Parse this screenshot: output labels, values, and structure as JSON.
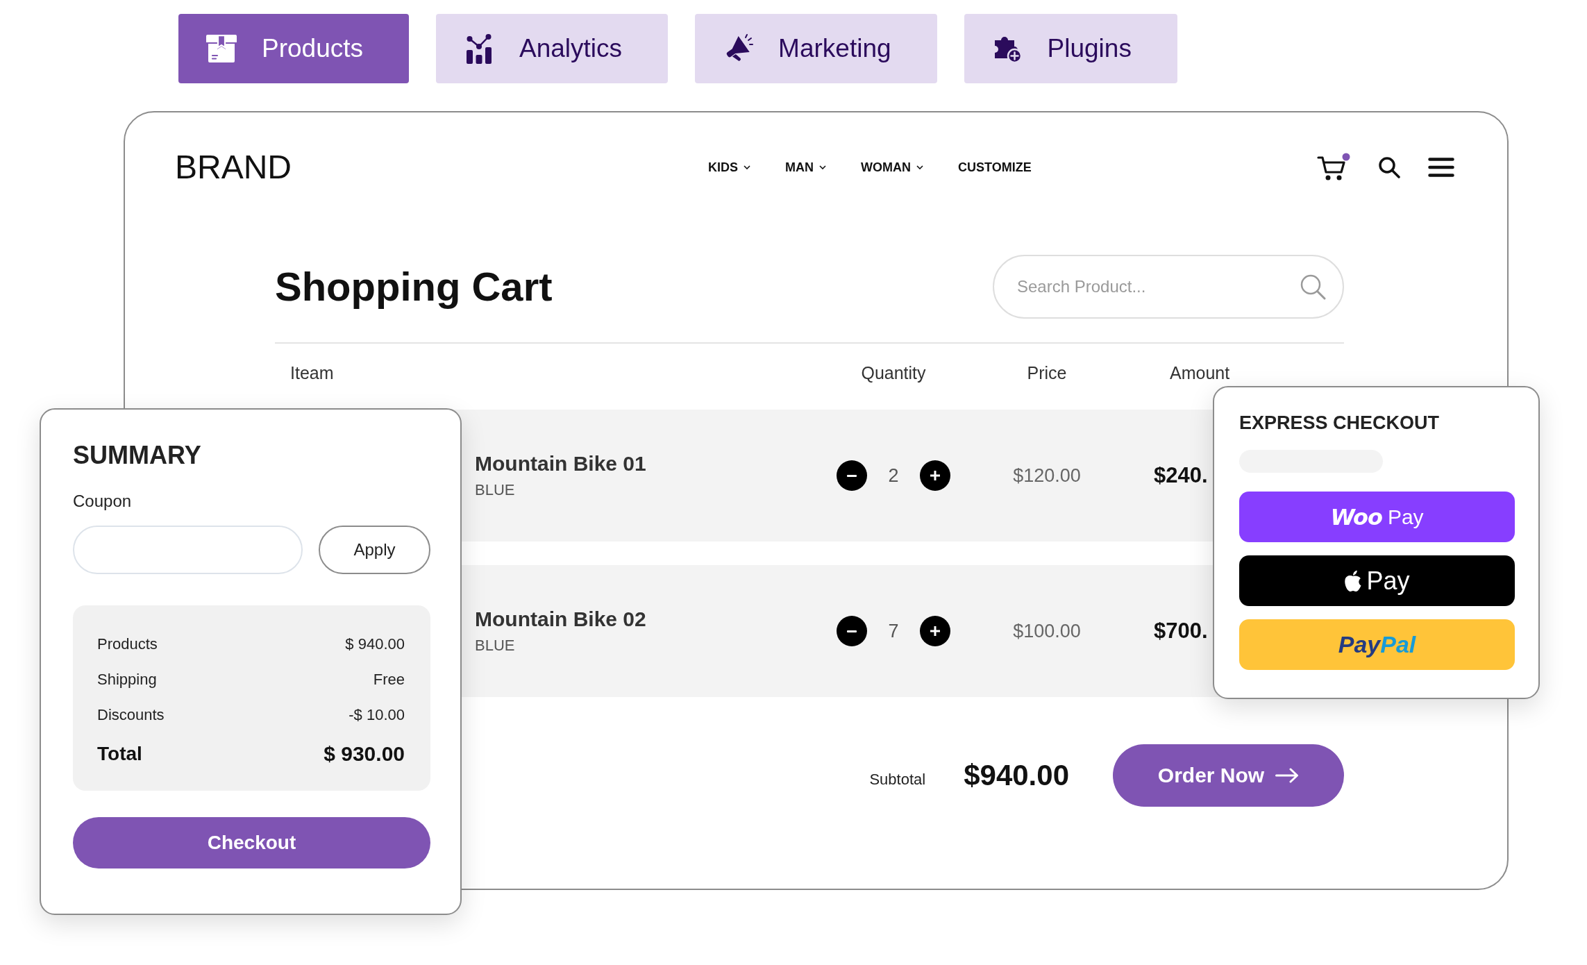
{
  "tabs": [
    {
      "label": "Products",
      "selected": true
    },
    {
      "label": "Analytics",
      "selected": false
    },
    {
      "label": "Marketing",
      "selected": false
    },
    {
      "label": "Plugins",
      "selected": false
    }
  ],
  "header": {
    "brand": "BRAND",
    "nav": [
      {
        "label": "KIDS",
        "dropdown": true
      },
      {
        "label": "MAN",
        "dropdown": true
      },
      {
        "label": "WOMAN",
        "dropdown": true
      },
      {
        "label": "CUSTOMIZE",
        "dropdown": false
      }
    ]
  },
  "cart": {
    "title": "Shopping Cart",
    "search": {
      "placeholder": "Search Product..."
    },
    "columns": [
      "Iteam",
      "Quantity",
      "Price",
      "Amount"
    ],
    "rows": [
      {
        "name": "Mountain Bike 01",
        "variant": "BLUE",
        "quantity": "2",
        "price": "$120.00",
        "amount": "$240."
      },
      {
        "name": "Mountain Bike 02",
        "variant": "BLUE",
        "quantity": "7",
        "price": "$100.00",
        "amount": "$700."
      }
    ],
    "subtotal": {
      "label": "Subtotal",
      "value": "$940.00"
    },
    "order_button": "Order Now"
  },
  "summary": {
    "title": "SUMMARY",
    "coupon": {
      "label": "Coupon",
      "button": "Apply"
    },
    "lines": [
      {
        "kind": "line",
        "label": "Products",
        "value": "$ 940.00"
      },
      {
        "kind": "line",
        "label": "Shipping",
        "value": "Free"
      },
      {
        "kind": "line",
        "label": "Discounts",
        "value": "-$ 10.00"
      },
      {
        "kind": "total",
        "label": "Total",
        "value": "$ 930.00"
      }
    ],
    "checkout_button": "Checkout"
  },
  "express_checkout": {
    "title": "EXPRESS CHECKOUT",
    "buttons": [
      {
        "kind": "woopay",
        "parts": [
          "Woo",
          "Pay"
        ]
      },
      {
        "kind": "applepay",
        "label": "Pay"
      },
      {
        "kind": "paypal",
        "parts": [
          "Pay",
          "Pal"
        ]
      }
    ]
  }
}
